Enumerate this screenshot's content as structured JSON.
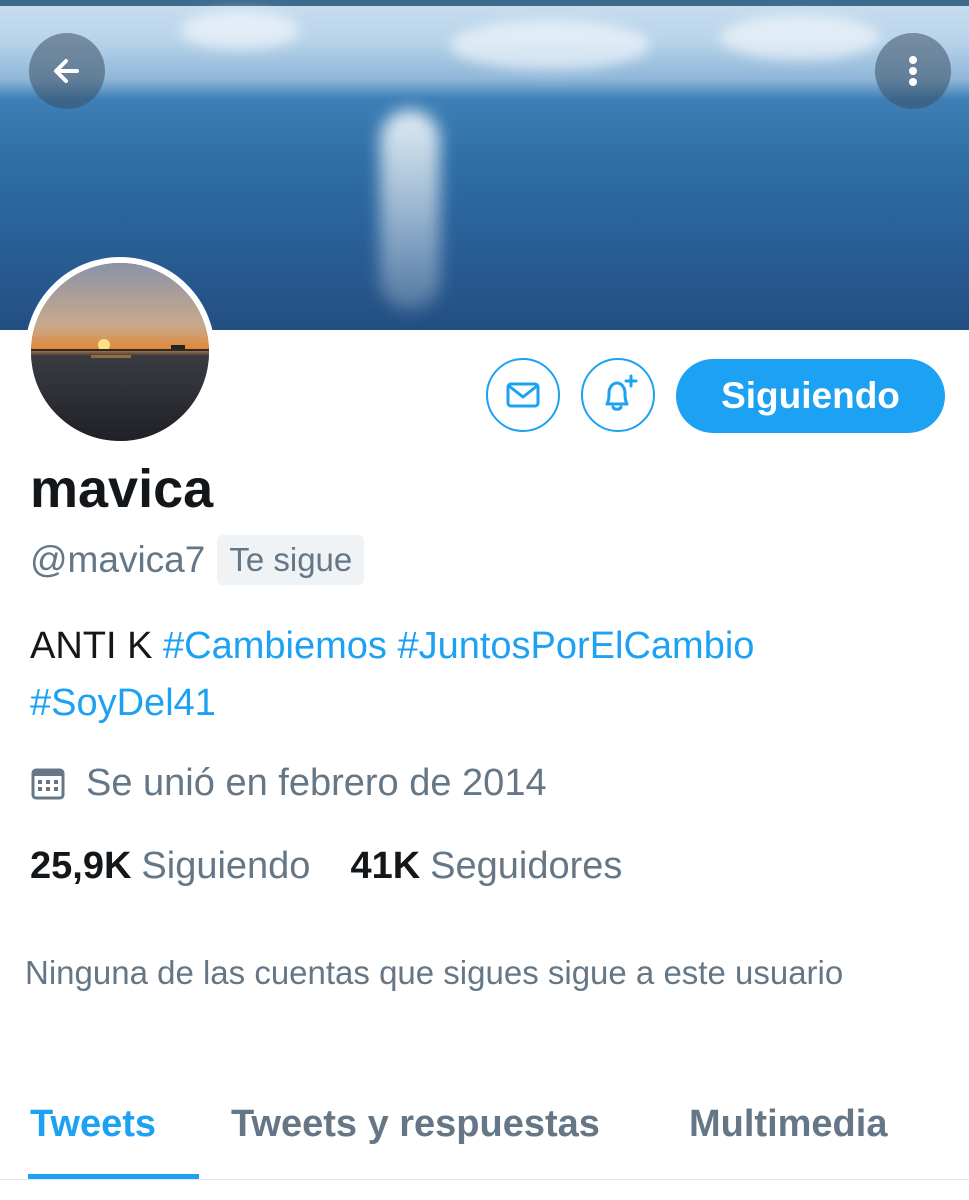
{
  "header": {
    "back_icon": "arrow-left-icon",
    "more_icon": "vertical-dots-icon"
  },
  "actions": {
    "message_icon": "envelope-icon",
    "notify_icon": "bell-plus-icon",
    "follow_label": "Siguiendo"
  },
  "profile": {
    "name": "mavica",
    "handle": "@mavica7",
    "follows_you": "Te sigue",
    "bio_text": "ANTI K",
    "bio_hashtags": [
      "#Cambiemos",
      "#JuntosPorElCambio",
      "#SoyDel41"
    ],
    "joined": "Se unió en febrero de 2014",
    "joined_icon": "calendar-icon"
  },
  "stats": {
    "following_count": "25,9K",
    "following_label": "Siguiendo",
    "followers_count": "41K",
    "followers_label": "Seguidores"
  },
  "note": "Ninguna de las cuentas que sigues sigue a este usuario",
  "tabs": [
    {
      "label": "Tweets",
      "active": true
    },
    {
      "label": "Tweets y respuestas",
      "active": false
    },
    {
      "label": "Multimedia",
      "active": false
    }
  ],
  "colors": {
    "accent": "#1da1f2",
    "secondary_text": "#657786"
  }
}
